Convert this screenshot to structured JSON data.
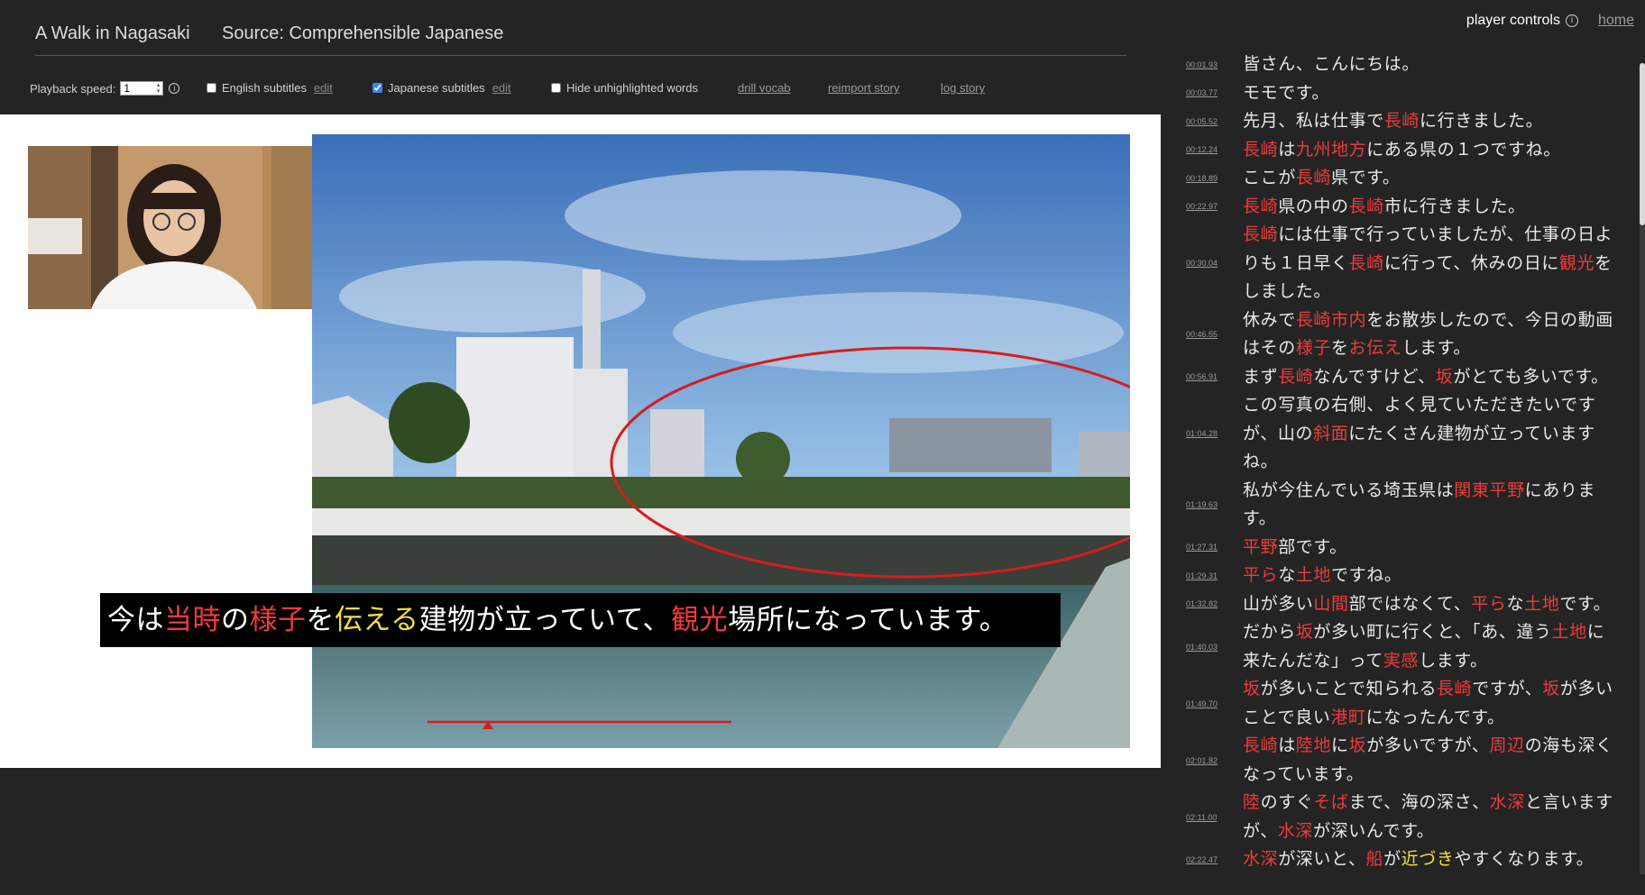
{
  "header": {
    "title": "A Walk in Nagasaki",
    "source": "Source: Comprehensible Japanese"
  },
  "controls": {
    "playback_label": "Playback speed:",
    "playback_value": "1",
    "english_label": "English subtitles",
    "english_checked": false,
    "japanese_label": "Japanese subtitles",
    "japanese_checked": true,
    "hide_label": "Hide unhighlighted words",
    "hide_checked": false,
    "edit_label": "edit",
    "drill_label": "drill vocab",
    "reimport_label": "reimport story",
    "log_label": "log story"
  },
  "top_right": {
    "player_controls": "player controls",
    "info": "i",
    "home": "home"
  },
  "subtitle": [
    {
      "t": "今は",
      "c": ""
    },
    {
      "t": "当時",
      "c": "red"
    },
    {
      "t": "の",
      "c": ""
    },
    {
      "t": "様子",
      "c": "red"
    },
    {
      "t": "を",
      "c": ""
    },
    {
      "t": "伝える",
      "c": "yellow"
    },
    {
      "t": "建物が立っていて、",
      "c": ""
    },
    {
      "t": "観光",
      "c": "red"
    },
    {
      "t": "場所になっています。",
      "c": ""
    }
  ],
  "transcript": [
    {
      "time": "00:01.93",
      "lines": [
        [
          {
            "t": "皆さん、こんにちは。",
            "c": ""
          }
        ]
      ]
    },
    {
      "time": "00:03.77",
      "lines": [
        [
          {
            "t": "モモです。",
            "c": ""
          }
        ]
      ]
    },
    {
      "time": "00:05.52",
      "lines": [
        [
          {
            "t": "先月、私は仕事で",
            "c": ""
          },
          {
            "t": "長崎",
            "c": "red"
          },
          {
            "t": "に行きました。",
            "c": ""
          }
        ]
      ]
    },
    {
      "time": "00:12.24",
      "lines": [
        [
          {
            "t": "長崎",
            "c": "red"
          },
          {
            "t": "は",
            "c": ""
          },
          {
            "t": "九州地方",
            "c": "red"
          },
          {
            "t": "にある県の１つですね。",
            "c": ""
          }
        ]
      ]
    },
    {
      "time": "00:18.89",
      "lines": [
        [
          {
            "t": "ここが",
            "c": ""
          },
          {
            "t": "長崎",
            "c": "red"
          },
          {
            "t": "県です。",
            "c": ""
          }
        ]
      ]
    },
    {
      "time": "00:22.97",
      "lines": [
        [
          {
            "t": "長崎",
            "c": "red"
          },
          {
            "t": "県の中の",
            "c": ""
          },
          {
            "t": "長崎",
            "c": "red"
          },
          {
            "t": "市に行きました。",
            "c": ""
          }
        ]
      ]
    },
    {
      "time": "00:30.04",
      "lines": [
        [
          {
            "t": "長崎",
            "c": "red"
          },
          {
            "t": "には仕事で行っていましたが、仕事の日よ",
            "c": ""
          }
        ],
        [
          {
            "t": "りも１日早く",
            "c": ""
          },
          {
            "t": "長崎",
            "c": "red"
          },
          {
            "t": "に行って、休みの日に",
            "c": ""
          },
          {
            "t": "観光",
            "c": "red"
          },
          {
            "t": "を",
            "c": ""
          }
        ],
        [
          {
            "t": "しました。",
            "c": ""
          }
        ]
      ]
    },
    {
      "time": "00:46.55",
      "lines": [
        [
          {
            "t": "休みで",
            "c": ""
          },
          {
            "t": "長崎市内",
            "c": "red"
          },
          {
            "t": "をお散歩したので、今日の動画",
            "c": ""
          }
        ],
        [
          {
            "t": "はその",
            "c": ""
          },
          {
            "t": "様子",
            "c": "red"
          },
          {
            "t": "を",
            "c": ""
          },
          {
            "t": "お伝え",
            "c": "red"
          },
          {
            "t": "します。",
            "c": ""
          }
        ]
      ]
    },
    {
      "time": "00:56.91",
      "lines": [
        [
          {
            "t": "まず",
            "c": ""
          },
          {
            "t": "長崎",
            "c": "red"
          },
          {
            "t": "なんですけど、",
            "c": ""
          },
          {
            "t": "坂",
            "c": "red"
          },
          {
            "t": "がとても多いです。",
            "c": ""
          }
        ]
      ]
    },
    {
      "time": "01:04.28",
      "lines": [
        [
          {
            "t": "この写真の右側、よく見ていただきたいです",
            "c": ""
          }
        ],
        [
          {
            "t": "が、山の",
            "c": ""
          },
          {
            "t": "斜面",
            "c": "red"
          },
          {
            "t": "にたくさん建物が立っています",
            "c": ""
          }
        ],
        [
          {
            "t": "ね。",
            "c": ""
          }
        ]
      ]
    },
    {
      "time": "01:19.63",
      "lines": [
        [
          {
            "t": "私が今住んでいる埼玉県は",
            "c": ""
          },
          {
            "t": "関東平野",
            "c": "red"
          },
          {
            "t": "にありま",
            "c": ""
          }
        ],
        [
          {
            "t": "す。",
            "c": ""
          }
        ]
      ]
    },
    {
      "time": "01:27.31",
      "lines": [
        [
          {
            "t": "平野",
            "c": "red"
          },
          {
            "t": "部です。",
            "c": ""
          }
        ]
      ]
    },
    {
      "time": "01:29.31",
      "lines": [
        [
          {
            "t": "平ら",
            "c": "red"
          },
          {
            "t": "な",
            "c": ""
          },
          {
            "t": "土地",
            "c": "red"
          },
          {
            "t": "ですね。",
            "c": ""
          }
        ]
      ]
    },
    {
      "time": "01:32.82",
      "lines": [
        [
          {
            "t": "山が多い",
            "c": ""
          },
          {
            "t": "山間",
            "c": "red"
          },
          {
            "t": "部ではなくて、",
            "c": ""
          },
          {
            "t": "平ら",
            "c": "red"
          },
          {
            "t": "な",
            "c": ""
          },
          {
            "t": "土地",
            "c": "red"
          },
          {
            "t": "です。",
            "c": ""
          }
        ]
      ]
    },
    {
      "time": "01:40.03",
      "lines": [
        [
          {
            "t": "だから",
            "c": ""
          },
          {
            "t": "坂",
            "c": "red"
          },
          {
            "t": "が多い町に行くと、「あ、違う",
            "c": ""
          },
          {
            "t": "土地",
            "c": "red"
          },
          {
            "t": "に",
            "c": ""
          }
        ],
        [
          {
            "t": "来たんだな」って",
            "c": ""
          },
          {
            "t": "実感",
            "c": "red"
          },
          {
            "t": "します。",
            "c": ""
          }
        ]
      ]
    },
    {
      "time": "01:49.70",
      "lines": [
        [
          {
            "t": "坂",
            "c": "red"
          },
          {
            "t": "が多いことで知られる",
            "c": ""
          },
          {
            "t": "長崎",
            "c": "red"
          },
          {
            "t": "ですが、",
            "c": ""
          },
          {
            "t": "坂",
            "c": "red"
          },
          {
            "t": "が多い",
            "c": ""
          }
        ],
        [
          {
            "t": "ことで良い",
            "c": ""
          },
          {
            "t": "港町",
            "c": "red"
          },
          {
            "t": "になったんです。",
            "c": ""
          }
        ]
      ]
    },
    {
      "time": "02:01.82",
      "lines": [
        [
          {
            "t": "長崎",
            "c": "red"
          },
          {
            "t": "は",
            "c": ""
          },
          {
            "t": "陸地",
            "c": "red"
          },
          {
            "t": "に",
            "c": ""
          },
          {
            "t": "坂",
            "c": "red"
          },
          {
            "t": "が多いですが、",
            "c": ""
          },
          {
            "t": "周辺",
            "c": "red"
          },
          {
            "t": "の海も深く",
            "c": ""
          }
        ],
        [
          {
            "t": "なっています。",
            "c": ""
          }
        ]
      ]
    },
    {
      "time": "02:11.00",
      "lines": [
        [
          {
            "t": "陸",
            "c": "red"
          },
          {
            "t": "のすぐ",
            "c": ""
          },
          {
            "t": "そば",
            "c": "red"
          },
          {
            "t": "まで、海の深さ、",
            "c": ""
          },
          {
            "t": "水深",
            "c": "red"
          },
          {
            "t": "と言います",
            "c": ""
          }
        ],
        [
          {
            "t": "が、",
            "c": ""
          },
          {
            "t": "水深",
            "c": "red"
          },
          {
            "t": "が深いんです。",
            "c": ""
          }
        ]
      ]
    },
    {
      "time": "02:22.47",
      "lines": [
        [
          {
            "t": "水深",
            "c": "red"
          },
          {
            "t": "が深いと、",
            "c": ""
          },
          {
            "t": "船",
            "c": "red"
          },
          {
            "t": "が",
            "c": ""
          },
          {
            "t": "近づき",
            "c": "yellow"
          },
          {
            "t": "やすくなります。",
            "c": ""
          }
        ]
      ]
    }
  ],
  "colors": {
    "highlight_red": "#ef3b3b",
    "highlight_yellow": "#f2e03a",
    "background": "#242424"
  }
}
